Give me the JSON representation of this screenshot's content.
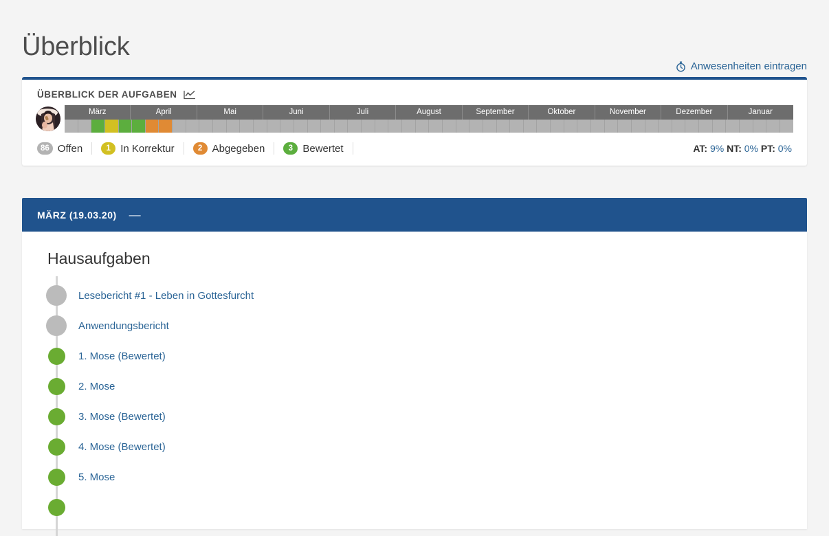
{
  "page": {
    "title": "Überblick",
    "background_color": "#f4f4f4"
  },
  "attendance_link": {
    "label": "Anwesenheiten eintragen",
    "icon": "stopwatch-icon",
    "color": "#2a6496"
  },
  "overview_card": {
    "title": "ÜBERBLICK DER AUFGABEN",
    "title_icon": "line-chart-icon",
    "accent_color": "#20538d",
    "avatar": "user-avatar-photo",
    "timeline": {
      "months": [
        "März",
        "April",
        "Mai",
        "Juni",
        "Juli",
        "August",
        "September",
        "Oktober",
        "November",
        "Dezember",
        "Januar"
      ],
      "header_bg": "#6d6d6d",
      "week_bg": "#b3b3b3",
      "weeks": [
        {
          "color": "#b3b3b3"
        },
        {
          "color": "#b3b3b3"
        },
        {
          "color": "#5cae3e"
        },
        {
          "color": "#d2c022"
        },
        {
          "color": "#5cae3e"
        },
        {
          "color": "#5cae3e"
        },
        {
          "color": "#e08a34"
        },
        {
          "color": "#e08a34"
        },
        {
          "color": "#b3b3b3"
        },
        {
          "color": "#b3b3b3"
        },
        {
          "color": "#b3b3b3"
        },
        {
          "color": "#b3b3b3"
        },
        {
          "color": "#b3b3b3"
        },
        {
          "color": "#b3b3b3"
        },
        {
          "color": "#b3b3b3"
        },
        {
          "color": "#b3b3b3"
        },
        {
          "color": "#b3b3b3"
        },
        {
          "color": "#b3b3b3"
        },
        {
          "color": "#b3b3b3"
        },
        {
          "color": "#b3b3b3"
        },
        {
          "color": "#b3b3b3"
        },
        {
          "color": "#b3b3b3"
        },
        {
          "color": "#b3b3b3"
        },
        {
          "color": "#b3b3b3"
        },
        {
          "color": "#b3b3b3"
        },
        {
          "color": "#b3b3b3"
        },
        {
          "color": "#b3b3b3"
        },
        {
          "color": "#b3b3b3"
        },
        {
          "color": "#b3b3b3"
        },
        {
          "color": "#b3b3b3"
        },
        {
          "color": "#b3b3b3"
        },
        {
          "color": "#b3b3b3"
        },
        {
          "color": "#b3b3b3"
        },
        {
          "color": "#b3b3b3"
        },
        {
          "color": "#b3b3b3"
        },
        {
          "color": "#b3b3b3"
        },
        {
          "color": "#b3b3b3"
        },
        {
          "color": "#b3b3b3"
        },
        {
          "color": "#b3b3b3"
        },
        {
          "color": "#b3b3b3"
        },
        {
          "color": "#b3b3b3"
        },
        {
          "color": "#b3b3b3"
        },
        {
          "color": "#b3b3b3"
        },
        {
          "color": "#b3b3b3"
        },
        {
          "color": "#b3b3b3"
        },
        {
          "color": "#b3b3b3"
        },
        {
          "color": "#b3b3b3"
        },
        {
          "color": "#b3b3b3"
        },
        {
          "color": "#b3b3b3"
        },
        {
          "color": "#b3b3b3"
        },
        {
          "color": "#b3b3b3"
        },
        {
          "color": "#b3b3b3"
        },
        {
          "color": "#b3b3b3"
        },
        {
          "color": "#b3b3b3"
        }
      ]
    },
    "legend": [
      {
        "count": "86",
        "label": "Offen",
        "color": "#b3b3b3"
      },
      {
        "count": "1",
        "label": "In Korrektur",
        "color": "#d2c022"
      },
      {
        "count": "2",
        "label": "Abgegeben",
        "color": "#e08a34"
      },
      {
        "count": "3",
        "label": "Bewertet",
        "color": "#5cae3e"
      }
    ],
    "percentages": [
      {
        "label": "AT:",
        "value": "9%"
      },
      {
        "label": "NT:",
        "value": "0%"
      },
      {
        "label": "PT:",
        "value": "0%"
      }
    ]
  },
  "month_section": {
    "header": "MÄRZ (19.03.20)",
    "collapse_icon": "minus-icon",
    "header_color": "#20538d",
    "heading": "Hausaufgaben",
    "tasks": [
      {
        "label": "Lesebericht #1 - Leben in Gottesfurcht",
        "status": "open",
        "dot_color": "#bbbbbb"
      },
      {
        "label": "Anwendungsbericht",
        "status": "open",
        "dot_color": "#bbbbbb"
      },
      {
        "label": "1. Mose (Bewertet)",
        "status": "rated",
        "dot_color": "#6aac32"
      },
      {
        "label": "2. Mose",
        "status": "rated",
        "dot_color": "#6aac32"
      },
      {
        "label": "3. Mose (Bewertet)",
        "status": "rated",
        "dot_color": "#6aac32"
      },
      {
        "label": "4. Mose (Bewertet)",
        "status": "rated",
        "dot_color": "#6aac32"
      },
      {
        "label": "5. Mose",
        "status": "rated",
        "dot_color": "#6aac32"
      },
      {
        "label": "",
        "status": "rated",
        "dot_color": "#6aac32"
      }
    ]
  }
}
